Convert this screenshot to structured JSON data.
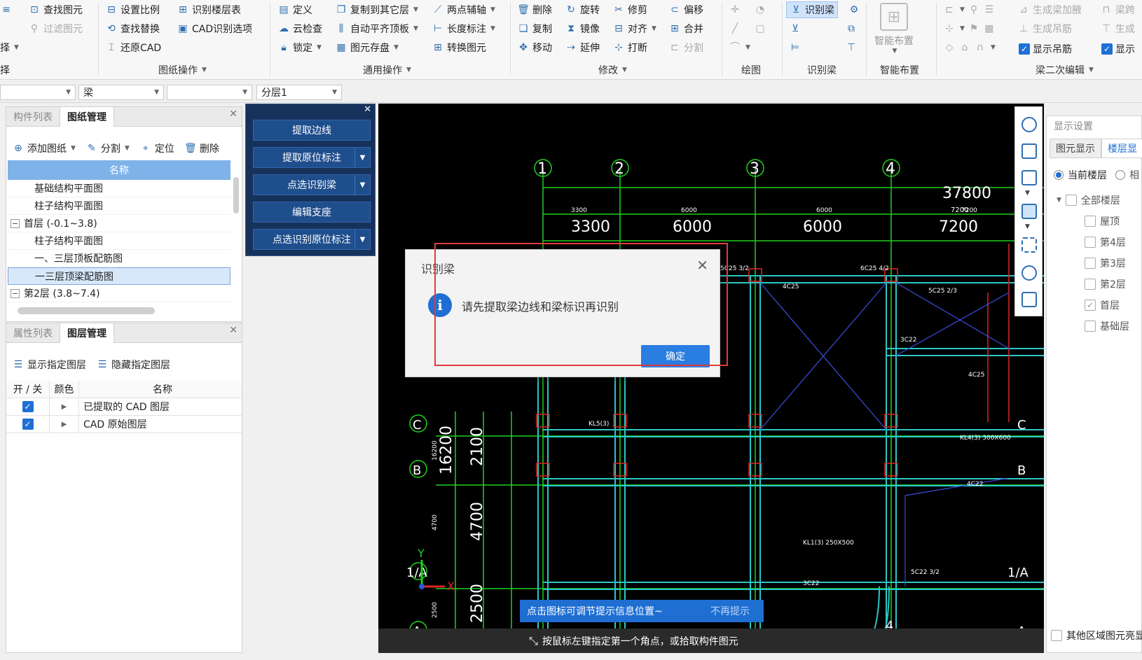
{
  "ribbon": {
    "col1": [
      {
        "label": "查找图元",
        "icon": "find-element-icon"
      },
      {
        "label": "过滤图元",
        "icon": "filter-element-icon",
        "disabled": true
      }
    ],
    "col1_left": [
      "择",
      "择"
    ],
    "col2": [
      {
        "label": "设置比例",
        "icon": "scale-icon"
      },
      {
        "label": "查找替换",
        "icon": "find-replace-icon"
      },
      {
        "label": "还原CAD",
        "icon": "restore-cad-icon"
      }
    ],
    "col3": [
      {
        "label": "识别楼层表",
        "icon": "floor-table-icon"
      },
      {
        "label": "CAD识别选项",
        "icon": "cad-options-icon"
      }
    ],
    "group_drawing_ops": "图纸操作",
    "col4": [
      {
        "label": "定义",
        "icon": "define-icon"
      },
      {
        "label": "云检查",
        "icon": "cloud-check-icon"
      },
      {
        "label": "锁定",
        "icon": "lock-icon"
      }
    ],
    "col5": [
      {
        "label": "复制到其它层",
        "icon": "copy-layer-icon"
      },
      {
        "label": "自动平齐顶板",
        "icon": "align-top-icon"
      },
      {
        "label": "图元存盘",
        "icon": "save-element-icon"
      }
    ],
    "col6": [
      {
        "label": "两点辅轴",
        "icon": "two-point-axis-icon"
      },
      {
        "label": "长度标注",
        "icon": "length-dim-icon"
      },
      {
        "label": "转换图元",
        "icon": "convert-element-icon"
      }
    ],
    "group_common_ops": "通用操作",
    "col7": [
      {
        "label": "删除",
        "icon": "delete-icon"
      },
      {
        "label": "复制",
        "icon": "copy-icon"
      },
      {
        "label": "移动",
        "icon": "move-icon"
      }
    ],
    "col8": [
      {
        "label": "旋转",
        "icon": "rotate-icon"
      },
      {
        "label": "镜像",
        "icon": "mirror-icon"
      },
      {
        "label": "延伸",
        "icon": "extend-icon"
      }
    ],
    "col9": [
      {
        "label": "修剪",
        "icon": "trim-icon"
      },
      {
        "label": "对齐",
        "icon": "align-icon"
      },
      {
        "label": "打断",
        "icon": "break-icon"
      }
    ],
    "col10": [
      {
        "label": "偏移",
        "icon": "offset-icon"
      },
      {
        "label": "合并",
        "icon": "merge-icon"
      },
      {
        "label": "分割",
        "icon": "split-icon",
        "disabled": true
      }
    ],
    "group_modify": "修改",
    "group_draw": "绘图",
    "recognize_beam": "识别梁",
    "group_recognize_beam": "识别梁",
    "smart_layout": "智能布置",
    "group_smart_layout": "智能布置",
    "col_beam2": [
      {
        "label": "生成梁加腋",
        "icon": "beam-haunch-icon",
        "disabled": true
      },
      {
        "label": "生成吊筋",
        "icon": "hanger-bar-icon",
        "disabled": true
      },
      {
        "label": "显示吊筋",
        "icon": "show-hanger-checkbox"
      }
    ],
    "col_beam3": [
      {
        "label": "梁跨",
        "icon": "beam-span-icon",
        "disabled": true
      },
      {
        "label": "生成",
        "icon": "generate-icon",
        "disabled": true
      },
      {
        "label": "显示",
        "icon": "show-checkbox"
      }
    ],
    "group_beam_edit": "梁二次编辑"
  },
  "filterbar": {
    "combo1": "",
    "combo2": "梁",
    "combo3": "",
    "combo4": "分层1"
  },
  "leftTop": {
    "tabs": [
      "构件列表",
      "图纸管理"
    ],
    "tools": [
      "添加图纸",
      "分割",
      "定位",
      "删除"
    ],
    "column": "名称",
    "rows": [
      {
        "text": "基础结构平面图",
        "level": 2
      },
      {
        "text": "柱子结构平面图",
        "level": 2
      },
      {
        "text": "首层 (-0.1~3.8)",
        "level": 1,
        "expander": "−"
      },
      {
        "text": "柱子结构平面图",
        "level": 2
      },
      {
        "text": "一、三层顶板配筋图",
        "level": 2
      },
      {
        "text": "一三层顶梁配筋图",
        "level": 2,
        "selected": true
      },
      {
        "text": "第2层 (3.8~7.4)",
        "level": 1,
        "expander": "−"
      }
    ]
  },
  "leftBottom": {
    "tabs": [
      "属性列表",
      "图层管理"
    ],
    "tools": [
      "显示指定图层",
      "隐藏指定图层"
    ],
    "headers": [
      "开 / 关",
      "颜色",
      "名称"
    ],
    "rows": [
      {
        "on": true,
        "name": "已提取的 CAD 图层"
      },
      {
        "on": true,
        "name": "CAD 原始图层"
      }
    ]
  },
  "floatPanel": {
    "buttons": [
      {
        "label": "提取边线",
        "dropdown": false
      },
      {
        "label": "提取原位标注",
        "dropdown": true
      },
      {
        "label": "点选识别梁",
        "dropdown": true
      },
      {
        "label": "编辑支座",
        "dropdown": false
      },
      {
        "label": "点选识别原位标注",
        "dropdown": true
      }
    ]
  },
  "drawing": {
    "axes_top": [
      "1",
      "2",
      "3",
      "4"
    ],
    "axes_left": [
      "C",
      "B",
      "1/A",
      "A"
    ],
    "axes_right": [
      "C",
      "B",
      "1/A",
      "A"
    ],
    "bottom_axis": "4",
    "total_dim": "37800",
    "total_dim_small": "7200",
    "spans_small": [
      "3300",
      "6000",
      "6000",
      "7200"
    ],
    "spans": [
      "3300",
      "6000",
      "6000",
      "7200"
    ],
    "left_dims": [
      "16200",
      "2100",
      "4700",
      "2500"
    ],
    "left_dims_small": [
      "16200",
      "4700",
      "2500"
    ],
    "labels": [
      "5C25 3/2",
      "6C25 4/2",
      "5C25 2/3",
      "4C25",
      "3C22",
      "5C22 3/2",
      "KL1(3) 250X500",
      "KL4(3) 300X600",
      "KL5(3)",
      "4C25",
      "3C22",
      "4C22"
    ],
    "axis_y": "Y",
    "axis_x": "X"
  },
  "dialog": {
    "title": "识别梁",
    "message": "请先提取梁边线和梁标识再识别",
    "ok": "确定"
  },
  "tip": {
    "text": "点击图标可调节提示信息位置~",
    "dismiss": "不再提示"
  },
  "status": "按鼠标左键指定第一个角点，或拾取构件图元",
  "rightPanel": {
    "title": "显示设置",
    "tabs": [
      "图元显示",
      "楼层显"
    ],
    "radio1": "当前楼层",
    "radio2": "相",
    "allFloors": "全部楼层",
    "floors": [
      {
        "name": "屋顶",
        "checked": false
      },
      {
        "name": "第4层",
        "checked": false
      },
      {
        "name": "第3层",
        "checked": false
      },
      {
        "name": "第2层",
        "checked": false
      },
      {
        "name": "首层",
        "checked": true
      },
      {
        "name": "基础层",
        "checked": false
      }
    ],
    "other": "其他区域图元亮显"
  },
  "colors": {
    "accent": "#1f6fd3",
    "cad_green": "#1fd11f",
    "cad_cyan": "#2bc7c7",
    "cad_red": "#e02424",
    "cad_white": "#ffffff",
    "highlight_red": "#e23a3a"
  }
}
